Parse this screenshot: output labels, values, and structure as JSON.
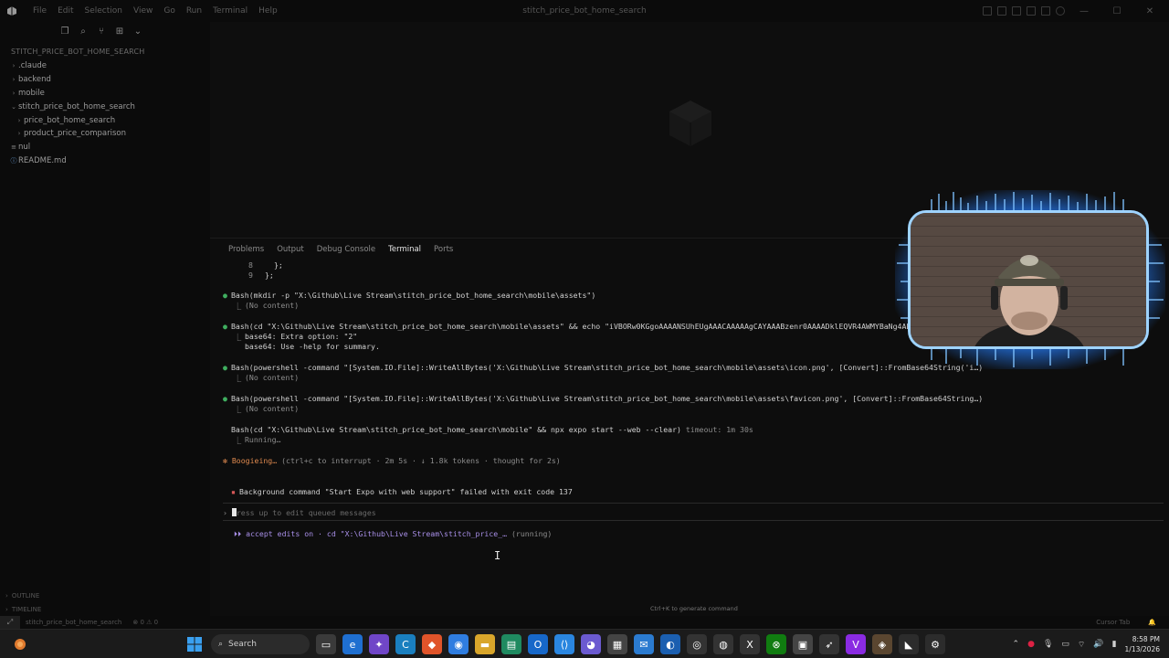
{
  "window": {
    "title": "stitch_price_bot_home_search",
    "menu": [
      "File",
      "Edit",
      "Selection",
      "View",
      "Go",
      "Run",
      "Terminal",
      "Help"
    ]
  },
  "explorer": {
    "project": "STITCH_PRICE_BOT_HOME_SEARCH",
    "items": [
      {
        "label": ".claude",
        "type": "folder",
        "expanded": false,
        "depth": 1
      },
      {
        "label": "backend",
        "type": "folder",
        "expanded": false,
        "depth": 1
      },
      {
        "label": "mobile",
        "type": "folder",
        "expanded": false,
        "depth": 1
      },
      {
        "label": "stitch_price_bot_home_search",
        "type": "folder",
        "expanded": true,
        "depth": 1
      },
      {
        "label": "price_bot_home_search",
        "type": "folder",
        "expanded": false,
        "depth": 2
      },
      {
        "label": "product_price_comparison",
        "type": "folder",
        "expanded": false,
        "depth": 2
      },
      {
        "label": "nul",
        "type": "file",
        "depth": 1
      },
      {
        "label": "README.md",
        "type": "file",
        "depth": 1
      }
    ],
    "outline": "OUTLINE",
    "timeline": "TIMELINE"
  },
  "panel": {
    "tabs": [
      "Problems",
      "Output",
      "Debug Console",
      "Terminal",
      "Ports"
    ],
    "active_tab": "Terminal"
  },
  "terminal": {
    "l8": "8",
    "l8_text": "};",
    "l9": "9",
    "l9_text": "};",
    "b1_cmd": "Bash(mkdir -p \"X:\\Github\\Live Stream\\stitch_price_bot_home_search\\mobile\\assets\")",
    "b1_res": "(No content)",
    "b2_cmd": "Bash(cd \"X:\\Github\\Live Stream\\stitch_price_bot_home_search\\mobile\\assets\" && echo \"iVBORw0KGgoAAAANSUhEUgAAACAAAAAgCAYAAABzenr0AAAADklEQVR4AWMYBaNg4AEABTg...",
    "b2_res1": "base64: Extra option: \"2\"",
    "b2_res2": "base64: Use -help for summary.",
    "b3_cmd": "Bash(powershell -command \"[System.IO.File]::WriteAllBytes('X:\\Github\\Live Stream\\stitch_price_bot_home_search\\mobile\\assets\\icon.png', [Convert]::FromBase64String('i…)",
    "b3_res": "(No content)",
    "b4_cmd": "Bash(powershell -command \"[System.IO.File]::WriteAllBytes('X:\\Github\\Live Stream\\stitch_price_bot_home_search\\mobile\\assets\\favicon.png', [Convert]::FromBase64String…)",
    "b4_res": "(No content)",
    "b5_cmd": "Bash(cd \"X:\\Github\\Live Stream\\stitch_price_bot_home_search\\mobile\" && npx expo start --web --clear)",
    "b5_timeout": "timeout: 1m 30s",
    "b5_res": "Running…",
    "status_word": "Boogieing…",
    "status_rest": "(ctrl+c to interrupt · 2m 5s · ↓ 1.8k tokens · thought for 2s)",
    "bg_msg": "Background command \"Start Expo with web support\" failed with exit code 137",
    "prompt_hint": "ress up to edit queued messages",
    "mode_label": "accept edits on",
    "mode_rest": "· cd \"X:\\Github\\Live Stream\\stitch_price_…",
    "mode_running": "(running)",
    "generate_hint": "Ctrl+K to generate command"
  },
  "statusbar": {
    "branch": "stitch_price_bot_home_search",
    "problems": "⊗ 0 ⚠ 0",
    "right": "Cursor Tab"
  },
  "taskbar": {
    "search": "Search",
    "time": "8:58 PM",
    "date": "1/13/2026"
  },
  "colors": {
    "accent_blue": "#2b70c8",
    "bullet_green": "#3fae5f",
    "error_red": "#d65757",
    "status_orange": "#e08a4f",
    "mode_purple": "#a88fe8"
  }
}
